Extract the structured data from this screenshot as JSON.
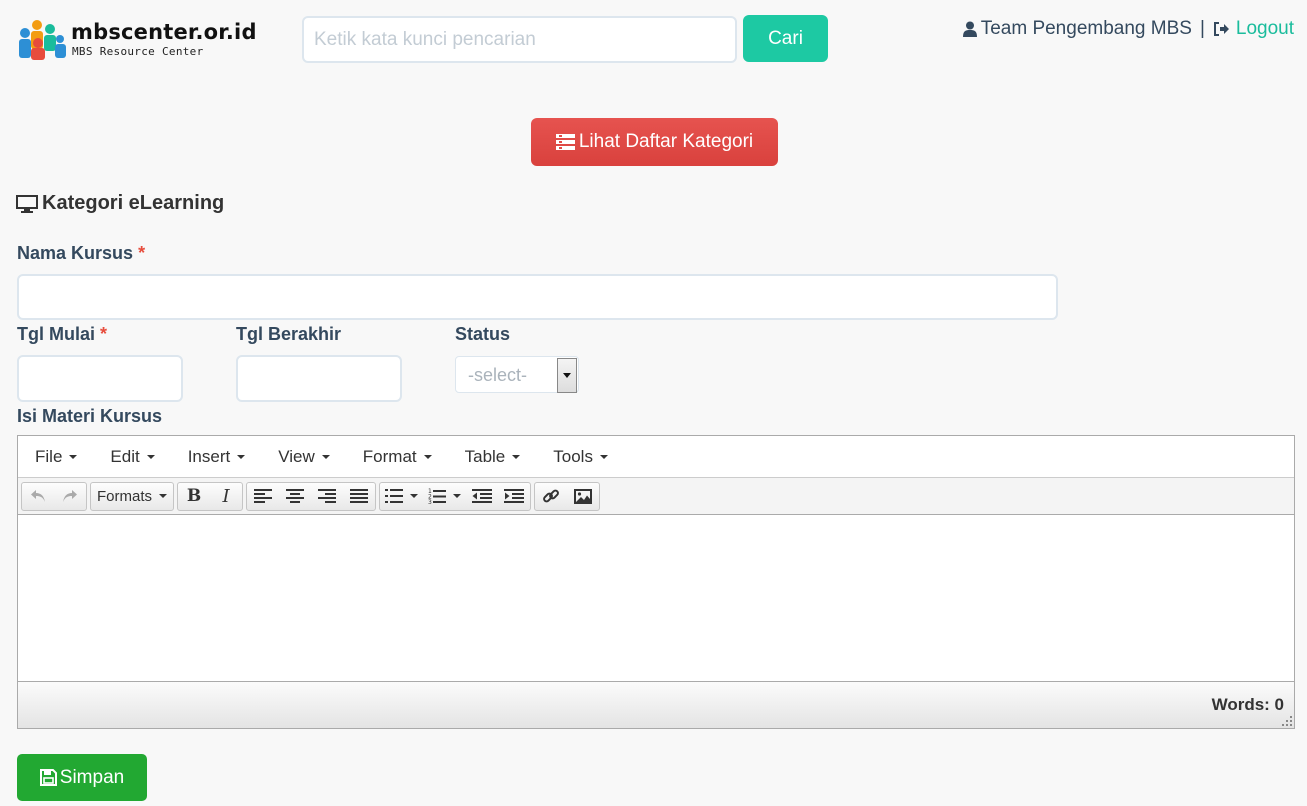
{
  "header": {
    "logo_title": "mbscenter.or.id",
    "logo_subtitle": "MBS Resource Center",
    "search_placeholder": "Ketik kata kunci pencarian",
    "search_value": "",
    "search_button": "Cari",
    "user_name": "Team Pengembang MBS",
    "separator": "|",
    "logout_label": "Logout"
  },
  "actions": {
    "list_categories_label": "Lihat Daftar Kategori",
    "save_label": "Simpan"
  },
  "form": {
    "section_title": "Kategori eLearning",
    "required_mark": "*",
    "course_name_label": "Nama Kursus",
    "course_name_value": "",
    "start_date_label": "Tgl Mulai",
    "start_date_value": "",
    "end_date_label": "Tgl Berakhir",
    "end_date_value": "",
    "status_label": "Status",
    "status_selected": "-select-",
    "content_label": "Isi Materi Kursus"
  },
  "editor": {
    "menus": [
      "File",
      "Edit",
      "Insert",
      "View",
      "Format",
      "Table",
      "Tools"
    ],
    "formats_label": "Formats",
    "bold_glyph": "B",
    "italic_glyph": "I",
    "word_count": "Words: 0"
  },
  "colors": {
    "accent": "#1dc9a3",
    "danger": "#d9413d",
    "success": "#22a832",
    "required": "#e74c3c"
  }
}
